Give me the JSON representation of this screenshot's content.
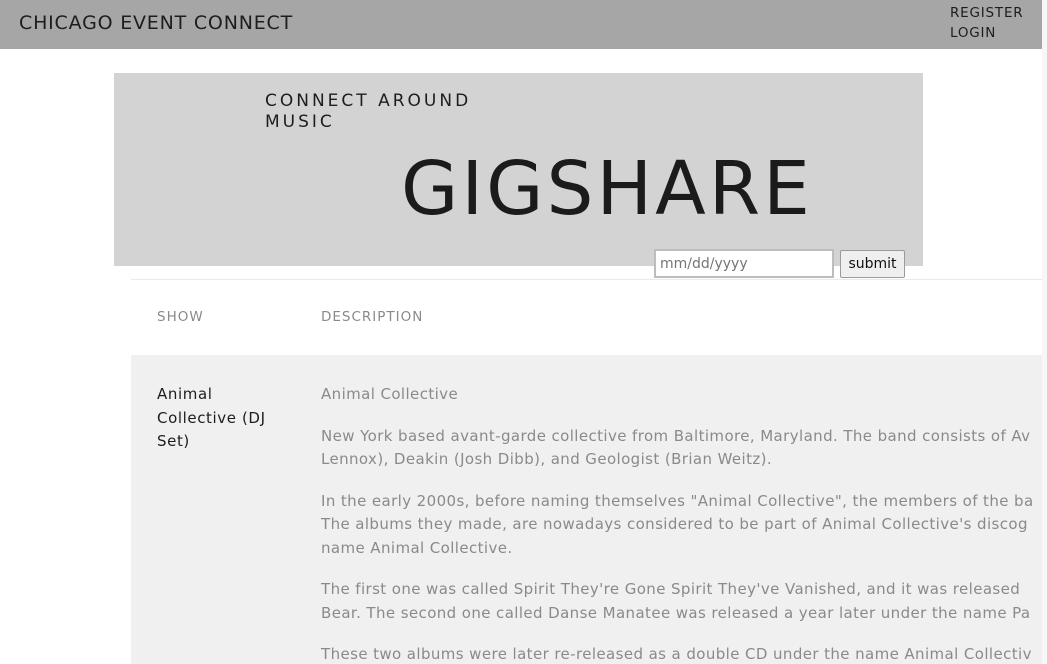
{
  "header": {
    "site_title": "CHICAGO EVENT CONNECT",
    "nav": {
      "register": "REGISTER",
      "login": "LOGIN"
    }
  },
  "hero": {
    "tagline": "CONNECT AROUND MUSIC",
    "brand": "GIGSHARE"
  },
  "search": {
    "date_placeholder": "mm/dd/yyyy",
    "submit_label": "submit"
  },
  "table": {
    "columns": [
      "SHOW",
      "DESCRIPTION"
    ],
    "rows": [
      {
        "show": "Animal Collective (DJ Set)",
        "description_lines": [
          "Animal Collective",
          "New York based avant-garde collective from Baltimore, Maryland. The band consists of Av",
          "Lennox), Deakin (Josh Dibb), and Geologist (Brian Weitz).",
          "In the early 2000s, before naming themselves \"Animal Collective\", the members of the ba",
          "The albums they made, are nowadays considered to be part of Animal Collective's discog",
          "name Animal Collective.",
          "The first one was called Spirit They're Gone Spirit They've Vanished, and it was released",
          "Bear. The second one called Danse Manatee was released a year later under the name Pa",
          "These two albums were later re-released as a double CD under the name Animal Collectiv"
        ]
      }
    ]
  }
}
